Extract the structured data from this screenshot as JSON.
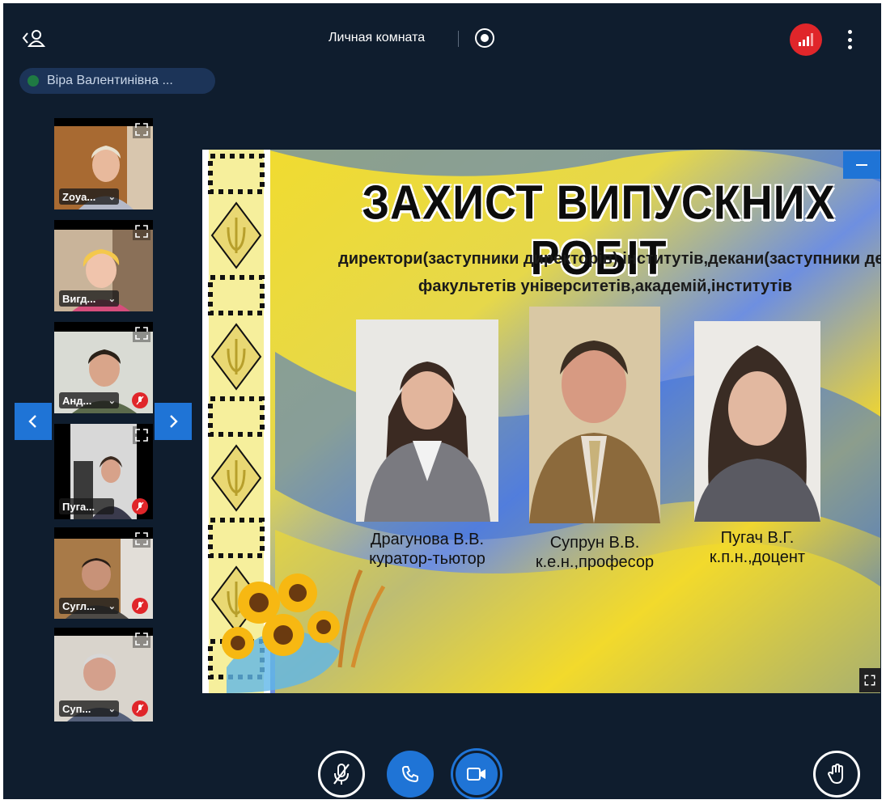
{
  "header": {
    "room_title": "Личная комната",
    "speaker_name": "Віра Валентинівна ..."
  },
  "icons": {
    "back": "person-back-icon",
    "record": "record-icon",
    "signal": "signal-bars-icon",
    "more": "more-vertical-icon",
    "expand": "expand-icon",
    "mute": "mic-off-icon",
    "minimize": "minimize-icon",
    "hand": "raise-hand-icon",
    "phone": "phone-icon",
    "video": "video-camera-icon"
  },
  "participants": [
    {
      "label": "Zoya...",
      "muted": false
    },
    {
      "label": "Вигд...",
      "muted": false
    },
    {
      "label": "Анд...",
      "muted": true
    },
    {
      "label": "Пуга...",
      "muted": true
    },
    {
      "label": "Сугл...",
      "muted": true
    },
    {
      "label": "Суп...",
      "muted": true
    }
  ],
  "slide": {
    "title": "ЗАХИСТ ВИПУСКНИХ РОБІТ",
    "subtitle_line1": "директори(заступники директорів) інститутів,декани(заступники деканів)",
    "subtitle_line2": "факультетів університетів,академій,інститутів",
    "people": [
      {
        "name": "Драгунова В.В.",
        "role": "куратор-тьютор"
      },
      {
        "name": "Супрун В.В.",
        "role": "к.е.н.,професор"
      },
      {
        "name": "Пугач В.Г.",
        "role": "к.п.н.,доцент"
      }
    ]
  },
  "colors": {
    "background": "#0f1d2e",
    "accent": "#1f74d6",
    "alert": "#e0262a",
    "speaker_chip": "#1c3458",
    "flag_blue": "#3a6fd8",
    "flag_yellow": "#f2dc2c"
  }
}
